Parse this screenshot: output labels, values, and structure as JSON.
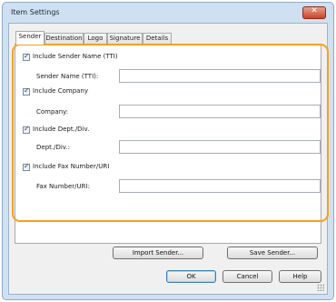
{
  "window": {
    "title": "Item Settings",
    "close_symbol": "✕"
  },
  "tabs": [
    "Sender",
    "Destination",
    "Logo",
    "Signature",
    "Details"
  ],
  "fields": [
    {
      "checkbox_label": "Include Sender Name (TTI)",
      "field_label": "Sender Name (TTI):",
      "value": "",
      "checked": true
    },
    {
      "checkbox_label": "Include Company",
      "field_label": "Company:",
      "value": "",
      "checked": true
    },
    {
      "checkbox_label": "Include Dept./Div.",
      "field_label": "Dept./Div.:",
      "value": "",
      "checked": true
    },
    {
      "checkbox_label": "Include Fax Number/URI",
      "field_label": "Fax Number/URI:",
      "value": "",
      "checked": true
    }
  ],
  "buttons": {
    "import_sender": "Import Sender...",
    "save_sender": "Save Sender...",
    "ok": "OK",
    "cancel": "Cancel",
    "help": "Help"
  },
  "colors": {
    "highlight": "#f4a21e",
    "dialog_frame": "#cfe0f1",
    "close_button": "#c8442a"
  }
}
